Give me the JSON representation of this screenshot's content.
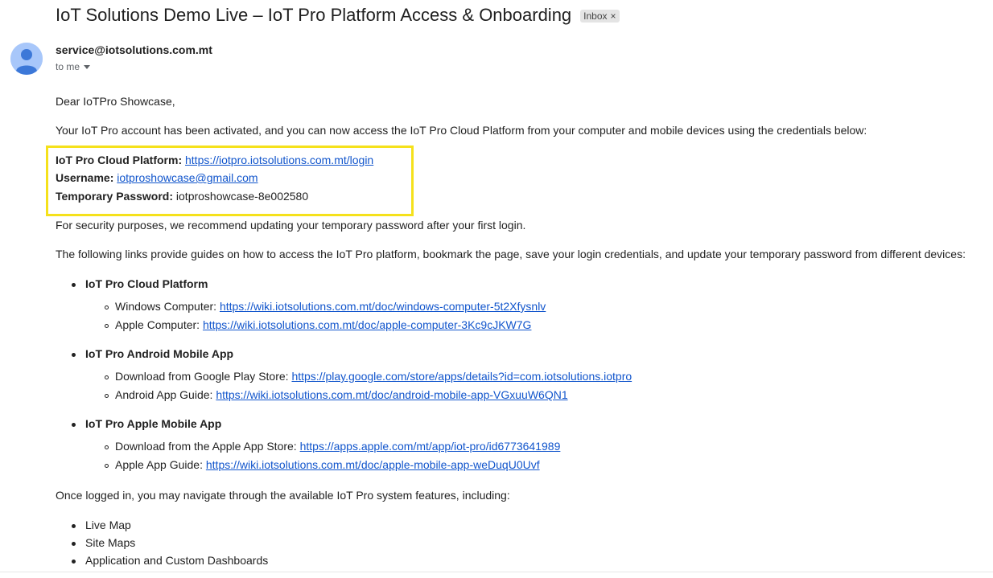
{
  "subject": "IoT Solutions Demo Live – IoT Pro Platform Access & Onboarding",
  "badge": {
    "label": "Inbox",
    "remove": "×"
  },
  "sender": "service@iotsolutions.com.mt",
  "recipient": "to me",
  "body": {
    "greeting": "Dear IoTPro Showcase,",
    "intro": "Your IoT Pro account has been activated, and you can now access the IoT Pro Cloud Platform from your computer and mobile devices using the credentials below:",
    "credentials": {
      "platform_label": "IoT Pro Cloud Platform:",
      "platform_url": "https://iotpro.iotsolutions.com.mt/login",
      "username_label": "Username:",
      "username": "iotproshowcase@gmail.com",
      "password_label": "Temporary Password:",
      "password": "iotproshowcase-8e002580"
    },
    "security": "For security purposes, we recommend updating your temporary password after your first login.",
    "guides_intro": "The following links provide guides on how to access the IoT Pro platform, bookmark the page, save your login credentials, and update your temporary password from different devices:",
    "sections": [
      {
        "title": "IoT Pro Cloud Platform",
        "items": [
          {
            "label": "Windows Computer:",
            "url": "https://wiki.iotsolutions.com.mt/doc/windows-computer-5t2Xfysnlv"
          },
          {
            "label": "Apple Computer:",
            "url": "https://wiki.iotsolutions.com.mt/doc/apple-computer-3Kc9cJKW7G"
          }
        ]
      },
      {
        "title": "IoT Pro Android Mobile App",
        "items": [
          {
            "label": "Download from Google Play Store:",
            "url": "https://play.google.com/store/apps/details?id=com.iotsolutions.iotpro"
          },
          {
            "label": "Android App Guide:",
            "url": "https://wiki.iotsolutions.com.mt/doc/android-mobile-app-VGxuuW6QN1"
          }
        ]
      },
      {
        "title": "IoT Pro Apple Mobile App",
        "items": [
          {
            "label": "Download from the Apple App Store:",
            "url": "https://apps.apple.com/mt/app/iot-pro/id6773641989"
          },
          {
            "label": "Apple App Guide:",
            "url": "https://wiki.iotsolutions.com.mt/doc/apple-mobile-app-weDuqU0Uvf"
          }
        ]
      }
    ],
    "features_intro": "Once logged in, you may navigate through the available IoT Pro system features, including:",
    "features": [
      "Live Map",
      "Site Maps",
      "Application and Custom Dashboards"
    ]
  },
  "colors": {
    "link": "#1155cc",
    "highlight_border": "#f5e11b",
    "avatar_bg": "#a8c7fa",
    "badge_bg": "#e4e4e4"
  },
  "icons": {
    "avatar": "person-avatar-icon",
    "recipient_toggle": "caret-down-icon"
  }
}
